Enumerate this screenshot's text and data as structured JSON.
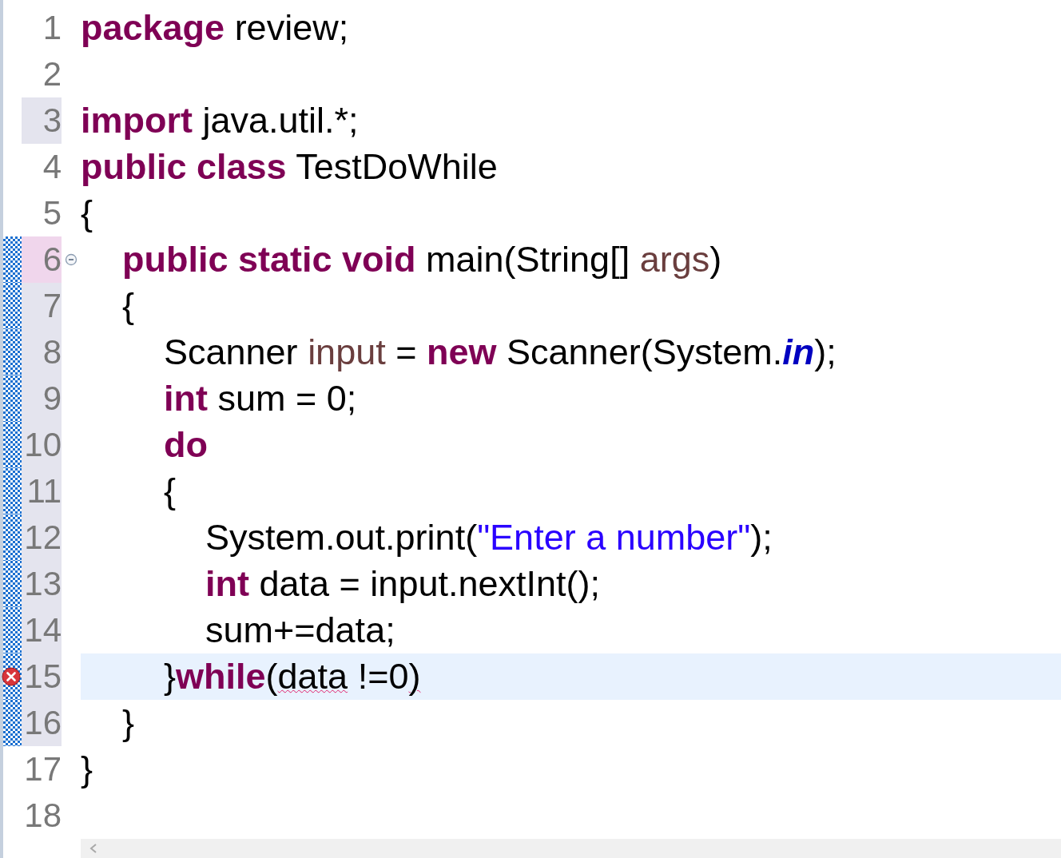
{
  "editor": {
    "lines": [
      {
        "number": "1",
        "shaded": false,
        "selected": false,
        "changed": false,
        "current": false,
        "error": false,
        "foldable": false,
        "tokens": [
          {
            "kind": "keyword",
            "text": "package"
          },
          {
            "kind": "plain",
            "text": " review;"
          }
        ]
      },
      {
        "number": "2",
        "shaded": false,
        "selected": false,
        "changed": false,
        "current": false,
        "error": false,
        "foldable": false
      },
      {
        "number": "3",
        "shaded": true,
        "selected": false,
        "changed": false,
        "current": false,
        "error": false,
        "foldable": false,
        "tokens": [
          {
            "kind": "keyword",
            "text": "import"
          },
          {
            "kind": "plain",
            "text": " java.util.*;"
          }
        ]
      },
      {
        "number": "4",
        "shaded": false,
        "selected": false,
        "changed": false,
        "current": false,
        "error": false,
        "foldable": false,
        "tokens": [
          {
            "kind": "keyword",
            "text": "public class"
          },
          {
            "kind": "plain",
            "text": " TestDoWhile"
          }
        ]
      },
      {
        "number": "5",
        "shaded": false,
        "selected": false,
        "changed": false,
        "current": false,
        "error": false,
        "foldable": false,
        "tokens": [
          {
            "kind": "plain",
            "text": "{"
          }
        ]
      },
      {
        "number": "6",
        "shaded": true,
        "selected": true,
        "changed": true,
        "current": false,
        "error": false,
        "foldable": true,
        "tokens": [
          {
            "kind": "keyword",
            "text": "\tpublic static void"
          },
          {
            "kind": "plain",
            "text": " main(String[] "
          },
          {
            "kind": "variable",
            "text": "args"
          },
          {
            "kind": "plain",
            "text": ")"
          }
        ]
      },
      {
        "number": "7",
        "shaded": true,
        "selected": false,
        "changed": true,
        "current": false,
        "error": false,
        "foldable": false,
        "tokens": [
          {
            "kind": "plain",
            "text": "\t{"
          }
        ]
      },
      {
        "number": "8",
        "shaded": true,
        "selected": false,
        "changed": true,
        "current": false,
        "error": false,
        "foldable": false,
        "tokens": [
          {
            "kind": "plain",
            "text": "\t\tScanner "
          },
          {
            "kind": "variable",
            "text": "input"
          },
          {
            "kind": "plain",
            "text": " = "
          },
          {
            "kind": "keyword",
            "text": "new"
          },
          {
            "kind": "plain",
            "text": " Scanner(System."
          },
          {
            "kind": "static",
            "text": "in"
          },
          {
            "kind": "plain",
            "text": ");"
          }
        ]
      },
      {
        "number": "9",
        "shaded": true,
        "selected": false,
        "changed": true,
        "current": false,
        "error": false,
        "foldable": false,
        "tokens": [
          {
            "kind": "keyword",
            "text": "\t\tint"
          },
          {
            "kind": "plain",
            "text": " sum = 0;"
          }
        ]
      },
      {
        "number": "10",
        "shaded": true,
        "selected": false,
        "changed": true,
        "current": false,
        "error": false,
        "foldable": false,
        "tokens": [
          {
            "kind": "keyword",
            "text": "\t\tdo"
          }
        ]
      },
      {
        "number": "11",
        "shaded": true,
        "selected": false,
        "changed": true,
        "current": false,
        "error": false,
        "foldable": false,
        "tokens": [
          {
            "kind": "plain",
            "text": "\t\t{"
          }
        ]
      },
      {
        "number": "12",
        "shaded": true,
        "selected": false,
        "changed": true,
        "current": false,
        "error": false,
        "foldable": false,
        "tokens": [
          {
            "kind": "plain",
            "text": "\t\t\tSystem.out.print("
          },
          {
            "kind": "string",
            "text": "\"Enter a number\""
          },
          {
            "kind": "plain",
            "text": ");"
          }
        ]
      },
      {
        "number": "13",
        "shaded": true,
        "selected": false,
        "changed": true,
        "current": false,
        "error": false,
        "foldable": false,
        "tokens": [
          {
            "kind": "keyword",
            "text": "\t\t\tint"
          },
          {
            "kind": "plain",
            "text": " data = input.nextInt();"
          }
        ]
      },
      {
        "number": "14",
        "shaded": true,
        "selected": false,
        "changed": true,
        "current": false,
        "error": false,
        "foldable": false,
        "tokens": [
          {
            "kind": "plain",
            "text": "\t\t\tsum+=data;"
          }
        ]
      },
      {
        "number": "15",
        "shaded": true,
        "selected": false,
        "changed": true,
        "current": true,
        "error": true,
        "foldable": false,
        "tokens": [
          {
            "kind": "plain",
            "text": "\t\t}"
          },
          {
            "kind": "keyword",
            "text": "while"
          },
          {
            "kind": "plain",
            "text": "("
          },
          {
            "kind": "flagged",
            "text": "data"
          },
          {
            "kind": "plain",
            "text": " !=0"
          },
          {
            "kind": "flagged",
            "text": ")"
          }
        ]
      },
      {
        "number": "16",
        "shaded": true,
        "selected": false,
        "changed": true,
        "current": false,
        "error": false,
        "foldable": false,
        "tokens": [
          {
            "kind": "plain",
            "text": "\t}"
          }
        ]
      },
      {
        "number": "17",
        "shaded": false,
        "selected": false,
        "changed": false,
        "current": false,
        "error": false,
        "foldable": false,
        "tokens": [
          {
            "kind": "plain",
            "text": "}"
          }
        ]
      },
      {
        "number": "18",
        "shaded": false,
        "selected": false,
        "changed": false,
        "current": false,
        "error": false,
        "foldable": false
      }
    ]
  }
}
